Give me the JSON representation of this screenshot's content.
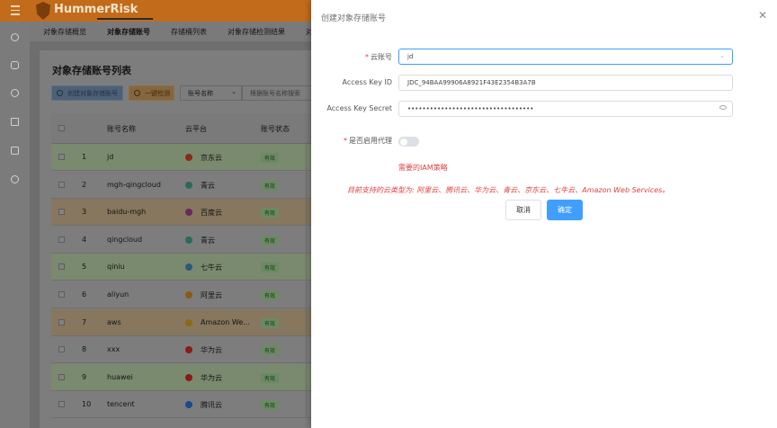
{
  "app": {
    "name": "HummerRisk"
  },
  "tabs": [
    {
      "label": "对象存储概览"
    },
    {
      "label": "对象存储账号"
    },
    {
      "label": "存储桶列表"
    },
    {
      "label": "对象存储检测结果"
    },
    {
      "label": "对"
    }
  ],
  "page": {
    "title": "对象存储账号列表",
    "create_button": "创建对象存储账号",
    "check_button": "一键检测",
    "filter_select": "账号名称",
    "filter_placeholder": "根据账号名称搜索"
  },
  "table": {
    "columns": [
      "账号名称",
      "云平台",
      "账号状态"
    ],
    "rows": [
      {
        "no": "1",
        "name": "jd",
        "platform": "京东云",
        "status": "有效",
        "icon_color": "#8a2a1a"
      },
      {
        "no": "2",
        "name": "mgh-qingcloud",
        "platform": "青云",
        "status": "有效",
        "icon_color": "#2a6a5a"
      },
      {
        "no": "3",
        "name": "baidu-mgh",
        "platform": "百度云",
        "status": "有效",
        "icon_color": "#6a2a5a"
      },
      {
        "no": "4",
        "name": "qingcloud",
        "platform": "青云",
        "status": "有效",
        "icon_color": "#2a6a5a"
      },
      {
        "no": "5",
        "name": "qiniu",
        "platform": "七牛云",
        "status": "有效",
        "icon_color": "#2a5a7a"
      },
      {
        "no": "6",
        "name": "aliyun",
        "platform": "阿里云",
        "status": "有效",
        "icon_color": "#8a5a1a"
      },
      {
        "no": "7",
        "name": "aws",
        "platform": "Amazon We...",
        "status": "有效",
        "icon_color": "#8a6a1a"
      },
      {
        "no": "8",
        "name": "xxx",
        "platform": "华为云",
        "status": "有效",
        "icon_color": "#8a1a1a"
      },
      {
        "no": "9",
        "name": "huawei",
        "platform": "华为云",
        "status": "有效",
        "icon_color": "#8a1a1a"
      },
      {
        "no": "10",
        "name": "tencent",
        "platform": "腾讯云",
        "status": "有效",
        "icon_color": "#1a4a8a"
      }
    ]
  },
  "drawer": {
    "title": "创建对象存储账号",
    "close_icon": "close-icon",
    "fields": {
      "cloud_account_label": "云账号",
      "cloud_account_value": "jd",
      "access_key_id_label": "Access Key ID",
      "access_key_id_value": "JDC_94BAA99906A8921F43E2354B3A7B",
      "access_key_secret_label": "Access Key Secret",
      "access_key_secret_value": "••••••••••••••••••••••••••••••••••",
      "proxy_label": "是否启用代理",
      "proxy_enabled": false
    },
    "iam_link": "需要的IAM策略",
    "support_text": "目前支持的云类型为: 阿里云、腾讯云、华为云、青云、京东云、七牛云、Amazon Web Services。",
    "cancel_button": "取消",
    "confirm_button": "确定"
  },
  "colors": {
    "topbar": "#c26b1b",
    "primary": "#409eff",
    "danger": "#e04040"
  }
}
